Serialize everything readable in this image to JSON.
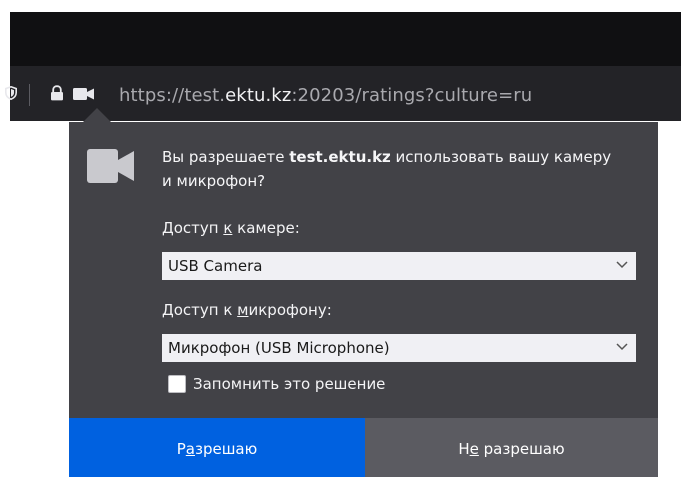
{
  "urlbar": {
    "scheme": "https://test.",
    "host": "ektu.kz",
    "rest": ":20203/ratings?culture=ru"
  },
  "prompt": {
    "before": "Вы разрешаете ",
    "site": "test.ektu.kz",
    "after": " использовать вашу камеру и микрофон?"
  },
  "camera": {
    "label_pre": "Доступ ",
    "label_key": "к",
    "label_post": " камере:",
    "selected": "USB Camera"
  },
  "microphone": {
    "label_pre": "Доступ к ",
    "label_key": "м",
    "label_post": "икрофону:",
    "selected": "Микрофон (USB Microphone)"
  },
  "remember": {
    "label": "Запомнить это решение",
    "checked": false
  },
  "buttons": {
    "allow_pre": "Р",
    "allow_key": "а",
    "allow_post": "зрешаю",
    "deny_pre": "Н",
    "deny_key": "е",
    "deny_post": " разрешаю"
  },
  "icons": {
    "urlbar": [
      "shield-icon",
      "lock-icon",
      "camera-icon"
    ],
    "prompt": "camera-icon",
    "select": "chevron-down-icon"
  },
  "colors": {
    "allow_button": "#0061e0",
    "deny_button": "#5b5b61",
    "popup_bg": "#424247"
  }
}
